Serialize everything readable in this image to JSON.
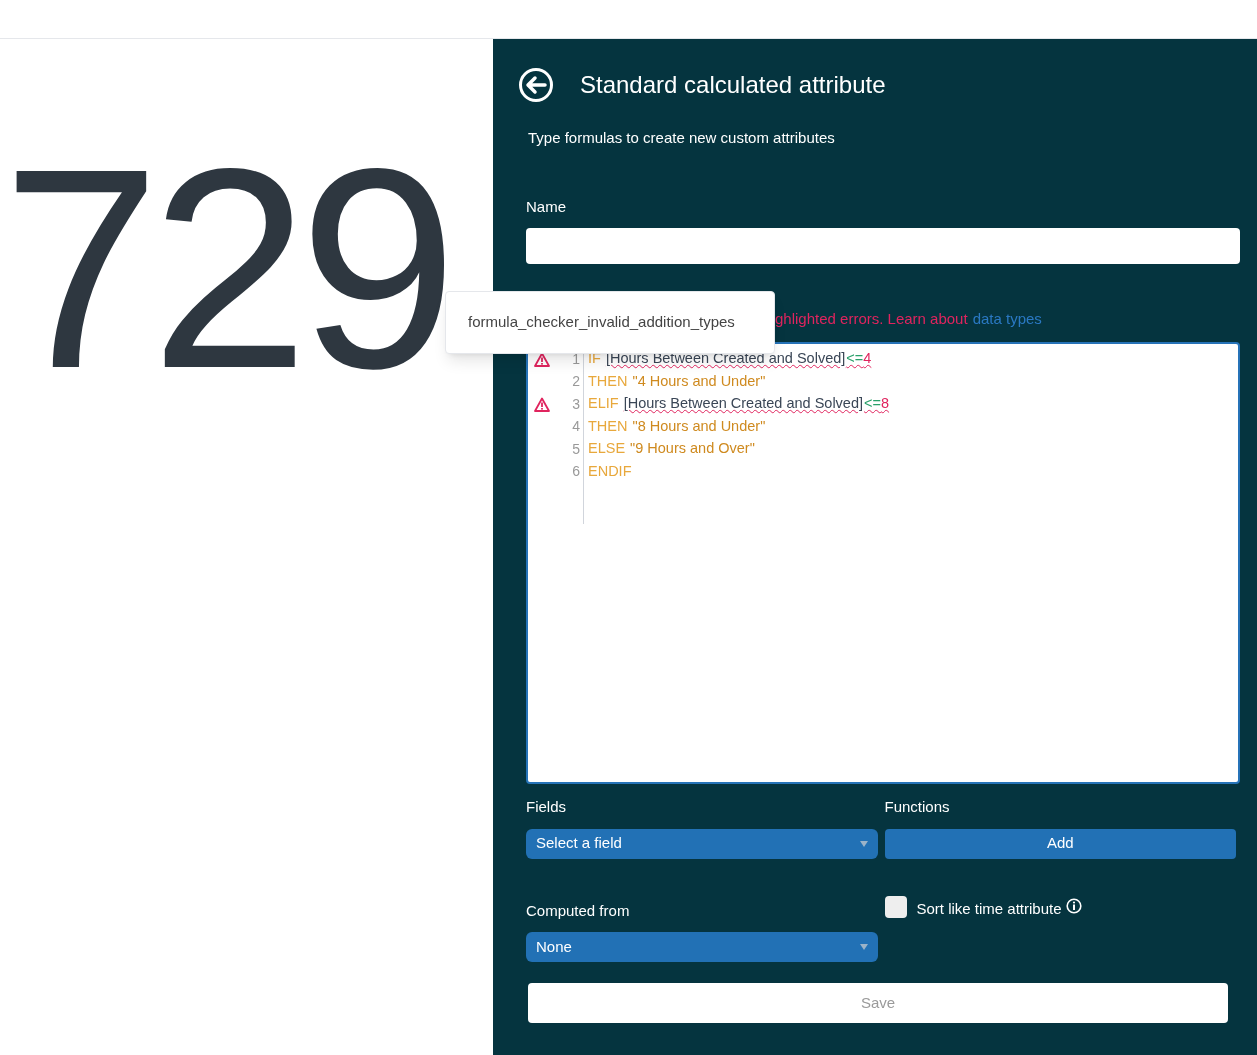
{
  "big_number": "729",
  "panel": {
    "title": "Standard calculated attribute",
    "subtitle": "Type formulas to create new custom attributes",
    "name_field": {
      "label": "Name"
    },
    "error_message": {
      "text": "ghlighted errors. Learn about",
      "link": "data types"
    },
    "tooltip": "formula_checker_invalid_addition_types",
    "editor_lines": [
      {
        "number": "1",
        "error": true,
        "tokens": [
          {
            "kind": "keyword",
            "text": "IF"
          },
          {
            "kind": "field",
            "text": "[Hours Between Created and Solved]"
          },
          {
            "kind": "operator",
            "text": "<="
          },
          {
            "kind": "number",
            "text": "4"
          }
        ]
      },
      {
        "number": "2",
        "error": false,
        "tokens": [
          {
            "kind": "keyword",
            "text": "THEN"
          },
          {
            "kind": "string",
            "text": "\"4 Hours and Under\""
          }
        ]
      },
      {
        "number": "3",
        "error": true,
        "tokens": [
          {
            "kind": "keyword",
            "text": "ELIF"
          },
          {
            "kind": "field",
            "text": "[Hours Between Created and Solved]"
          },
          {
            "kind": "operator",
            "text": "<="
          },
          {
            "kind": "number",
            "text": "8"
          }
        ]
      },
      {
        "number": "4",
        "error": false,
        "tokens": [
          {
            "kind": "keyword",
            "text": "THEN"
          },
          {
            "kind": "string",
            "text": "\"8 Hours and Under\""
          }
        ]
      },
      {
        "number": "5",
        "error": false,
        "tokens": [
          {
            "kind": "keyword",
            "text": "ELSE"
          },
          {
            "kind": "string",
            "text": "\"9 Hours and Over\""
          }
        ]
      },
      {
        "number": "6",
        "error": false,
        "tokens": [
          {
            "kind": "keyword",
            "text": "ENDIF"
          }
        ]
      }
    ],
    "fields": {
      "label": "Fields",
      "value": "Select a field"
    },
    "functions": {
      "label": "Functions",
      "button": "Add"
    },
    "computed_from": {
      "label": "Computed from",
      "value": "None"
    },
    "sort_like_time": {
      "label": "Sort like time attribute",
      "checked": false
    },
    "save": {
      "label": "Save",
      "disabled": true
    }
  }
}
